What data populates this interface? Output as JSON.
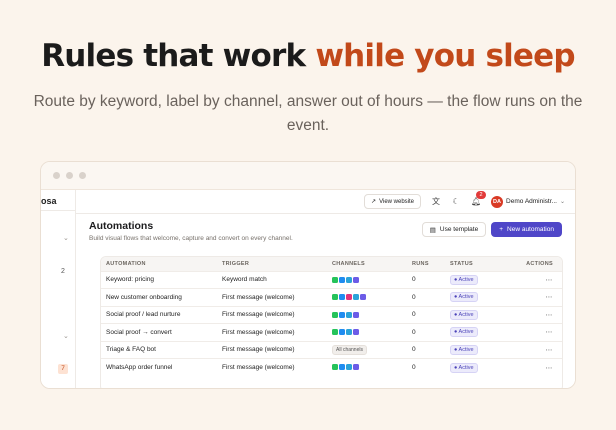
{
  "hero": {
    "title_start": "Rules that work ",
    "title_accent": "while you sleep",
    "subtitle": "Route by keyword, label by channel, answer out of hours — the flow runs on the event.",
    "accent_color": "#c2491a"
  },
  "sidebar": {
    "brand": "osa",
    "chevron": "⌄",
    "count": "2",
    "badge": "7"
  },
  "topbar": {
    "view_website": "View website",
    "notifications_count": "2",
    "avatar_initials": "DA",
    "user_name": "Demo Administr..."
  },
  "page": {
    "title": "Automations",
    "subtitle": "Build visual flows that welcome, capture and convert on every channel.",
    "use_template": "Use template",
    "new_automation": "New automation",
    "primary_color": "#4f46c8"
  },
  "table": {
    "headers": {
      "automation": "AUTOMATION",
      "trigger": "TRIGGER",
      "channels": "CHANNELS",
      "runs": "RUNS",
      "status": "STATUS",
      "actions": "ACTIONS"
    },
    "rows": [
      {
        "name": "Keyword: pricing",
        "trigger": "Keyword match",
        "channels": [
          "whatsapp",
          "messenger",
          "telegram",
          "discord"
        ],
        "runs": "0",
        "status": "● Active",
        "actions": "⋯"
      },
      {
        "name": "New customer onboarding",
        "trigger": "First message (welcome)",
        "channels": [
          "whatsapp",
          "messenger",
          "instagram",
          "telegram",
          "discord"
        ],
        "runs": "0",
        "status": "● Active",
        "actions": "⋯"
      },
      {
        "name": "Social proof / lead nurture",
        "trigger": "First message (welcome)",
        "channels": [
          "whatsapp",
          "messenger",
          "telegram",
          "discord"
        ],
        "runs": "0",
        "status": "● Active",
        "actions": "⋯"
      },
      {
        "name": "Social proof → convert",
        "trigger": "First message (welcome)",
        "channels": [
          "whatsapp",
          "messenger",
          "telegram",
          "discord"
        ],
        "runs": "0",
        "status": "● Active",
        "actions": "⋯"
      },
      {
        "name": "Triage & FAQ bot",
        "trigger": "First message (welcome)",
        "all_channels": "All channels",
        "runs": "0",
        "status": "● Active",
        "actions": "⋯"
      },
      {
        "name": "WhatsApp order funnel",
        "trigger": "First message (welcome)",
        "channels": [
          "whatsapp",
          "messenger",
          "telegram",
          "discord"
        ],
        "runs": "0",
        "status": "● Active",
        "actions": "⋯"
      }
    ]
  },
  "channel_colors": {
    "whatsapp": "#25c35a",
    "messenger": "#1f8cf0",
    "instagram": "#e0357a",
    "telegram": "#2aa3d8",
    "discord": "#6c5ce7"
  }
}
